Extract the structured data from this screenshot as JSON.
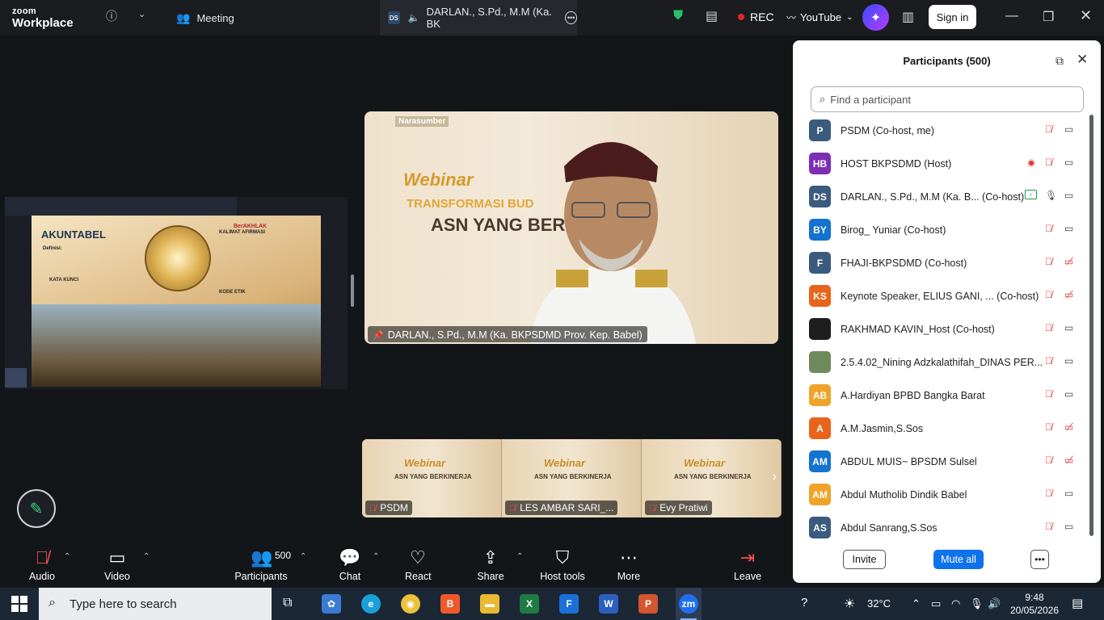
{
  "titlebar": {
    "logo_line1": "zoom",
    "logo_line2": "Workplace",
    "meeting_tab": "Meeting",
    "active_tab_initials": "DS",
    "active_tab_label": "DARLAN., S.Pd., M.M (Ka. BK",
    "rec_label": "REC",
    "youtube_label": "YouTube",
    "signin_label": "Sign in"
  },
  "stage": {
    "slide_title": "AKUNTABEL",
    "slide_brand": "BerAKHLAK",
    "slide_definisi": "Definisi:",
    "slide_kata_kunci": "KATA KUNCI",
    "slide_kalimat": "KALIMAT AFIRMASI",
    "slide_kode_etik": "KODE ETIK",
    "speaker_badge": "Narasumber",
    "speaker_webinar": "Webinar",
    "speaker_transformasi": "TRANSFORMASI BUD",
    "speaker_asn": "ASN YANG BERKI",
    "speaker_name": "DARLAN., S.Pd., M.M (Ka. BKPSDMD Prov. Kep. Babel)",
    "thumbs": [
      {
        "name": "PSDM",
        "webinar": "Webinar",
        "asn": "ASN YANG BERKINERJA"
      },
      {
        "name": "LES AMBAR SARI_...",
        "webinar": "Webinar",
        "asn": "ASN YANG BERKINERJA"
      },
      {
        "name": "Evy Pratiwi",
        "webinar": "Webinar",
        "asn": "ASN YANG BERKINERJA"
      }
    ]
  },
  "panel": {
    "title": "Participants (500)",
    "search_placeholder": "Find a participant",
    "invite_label": "Invite",
    "mute_all_label": "Mute all",
    "participants": [
      {
        "initials": "P",
        "name": "PSDM (Co-host, me)",
        "color": "#3b5b7e",
        "mic": "muted",
        "cam": "on"
      },
      {
        "initials": "HB",
        "name": "HOST BKPSDMD (Host)",
        "color": "#7d2fb4",
        "mic": "muted",
        "cam": "on",
        "rec": true
      },
      {
        "initials": "DS",
        "name": "DARLAN., S.Pd., M.M (Ka. B... (Co-host)",
        "color": "#3b5b7e",
        "mic": "on",
        "cam": "on",
        "share": true
      },
      {
        "initials": "BY",
        "name": "Birog_ Yuniar (Co-host)",
        "color": "#1473d1",
        "mic": "muted",
        "cam": "on"
      },
      {
        "initials": "F",
        "name": "FHAJI-BKPSDMD (Co-host)",
        "color": "#3b5b7e",
        "mic": "muted",
        "cam": "off"
      },
      {
        "initials": "KS",
        "name": "Keynote Speaker, ELIUS GANI, ...  (Co-host)",
        "color": "#e8641b",
        "mic": "muted",
        "cam": "off"
      },
      {
        "initials": "",
        "name": "RAKHMAD KAVIN_Host (Co-host)",
        "color": "#1e1e1e",
        "mic": "muted",
        "cam": "on"
      },
      {
        "initials": "",
        "name": "2.5.4.02_Nining Adzkalathifah_DINAS PER...",
        "color": "#6e8a5a",
        "mic": "muted",
        "cam": "on"
      },
      {
        "initials": "AB",
        "name": "A.Hardiyan BPBD Bangka Barat",
        "color": "#f0a32a",
        "mic": "muted",
        "cam": "on"
      },
      {
        "initials": "A",
        "name": "A.M.Jasmin,S.Sos",
        "color": "#e8641b",
        "mic": "muted",
        "cam": "off"
      },
      {
        "initials": "AM",
        "name": "ABDUL MUIS~ BPSDM Sulsel",
        "color": "#1473d1",
        "mic": "muted",
        "cam": "off"
      },
      {
        "initials": "AM",
        "name": "Abdul Mutholib Dindik Babel",
        "color": "#f0a32a",
        "mic": "muted",
        "cam": "on"
      },
      {
        "initials": "AS",
        "name": "Abdul Sanrang,S.Sos",
        "color": "#3b5b7e",
        "mic": "muted",
        "cam": "on"
      }
    ]
  },
  "toolbar": {
    "audio": "Audio",
    "video": "Video",
    "participants": "Participants",
    "participants_count": "500",
    "chat": "Chat",
    "react": "React",
    "share": "Share",
    "host_tools": "Host tools",
    "more": "More",
    "leave": "Leave"
  },
  "taskbar": {
    "search_placeholder": "Type here to search",
    "temperature": "32°C",
    "time": "9:48",
    "date": "20/05/2026"
  }
}
